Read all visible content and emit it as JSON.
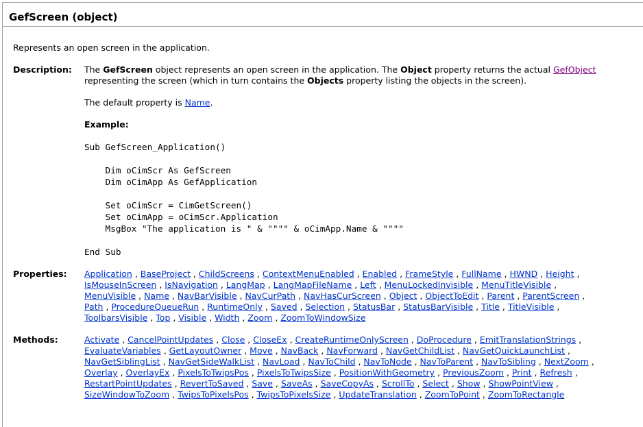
{
  "title": "GefScreen (object)",
  "summary": "Represents an open screen in the application.",
  "description": {
    "label": "Description:",
    "p1_seg1": "The ",
    "p1_bold1": "GefScreen",
    "p1_seg2": " object represents an open screen in the application. The ",
    "p1_bold2": "Object",
    "p1_seg3": " property returns the actual ",
    "p1_link": "GefObject",
    "p1_seg4": "representing the screen (which in turn contains the ",
    "p1_bold3": "Objects",
    "p1_seg5": " property listing the objects in the screen).",
    "p2_seg1": "The default property is ",
    "p2_link": "Name",
    "p2_seg2": ".",
    "example_label": "Example:"
  },
  "code": [
    "Sub GefScreen_Application()",
    "",
    "    Dim oCimScr As GefScreen",
    "    Dim oCimApp As GefApplication",
    "",
    "    Set oCimScr = CimGetScreen()",
    "    Set oCimApp = oCimScr.Application",
    "    MsgBox \"The application is \" & \"\"\"\" & oCimApp.Name & \"\"\"\"",
    "",
    "End Sub"
  ],
  "properties": {
    "label": "Properties:",
    "lines": [
      [
        "Application",
        "BaseProject",
        "ChildScreens",
        "ContextMenuEnabled",
        "Enabled",
        "FrameStyle",
        "FullName",
        "HWND",
        "Height"
      ],
      [
        "IsMouseInScreen",
        "IsNavigation",
        "LangMap",
        "LangMapFileName",
        "Left",
        "MenuLockedInvisible",
        "MenuTitleVisible"
      ],
      [
        "MenuVisible",
        "Name",
        "NavBarVisible",
        "NavCurPath",
        "NavHasCurScreen",
        "Object",
        "ObjectToEdit",
        "Parent",
        "ParentScreen"
      ],
      [
        "Path",
        "ProcedureQueueRun",
        "RuntimeOnly",
        "Saved",
        "Selection",
        "StatusBar",
        "StatusBarVisible",
        "Title",
        "TitleVisible"
      ],
      [
        "ToolbarsVisible",
        "Top",
        "Visible",
        "Width",
        "Zoom",
        "ZoomToWindowSize"
      ]
    ]
  },
  "methods": {
    "label": "Methods:",
    "lines": [
      [
        "Activate",
        "CancelPointUpdates",
        "Close",
        "CloseEx",
        "CreateRuntimeOnlyScreen",
        "DoProcedure",
        "EmitTranslationStrings"
      ],
      [
        "EvaluateVariables",
        "GetLayoutOwner",
        "Move",
        "NavBack",
        "NavForward",
        "NavGetChildList",
        "NavGetQuickLaunchList"
      ],
      [
        "NavGetSiblingList",
        "NavGetSideWalkList",
        "NavLoad",
        "NavToChild",
        "NavToNode",
        "NavToParent",
        "NavToSibling",
        "NextZoom"
      ],
      [
        "Overlay",
        "OverlayEx",
        "PixelsToTwipsPos",
        "PixelsToTwipsSize",
        "PositionWithGeometry",
        "PreviousZoom",
        "Print",
        "Refresh"
      ],
      [
        "RestartPointUpdates",
        "RevertToSaved",
        "Save",
        "SaveAs",
        "SaveCopyAs",
        "ScrollTo",
        "Select",
        "Show",
        "ShowPointView"
      ],
      [
        "SizeWindowToZoom",
        "TwipsToPixelsPos",
        "TwipsToPixelsSize",
        "UpdateTranslation",
        "ZoomToPoint",
        "ZoomToRectangle"
      ]
    ]
  }
}
